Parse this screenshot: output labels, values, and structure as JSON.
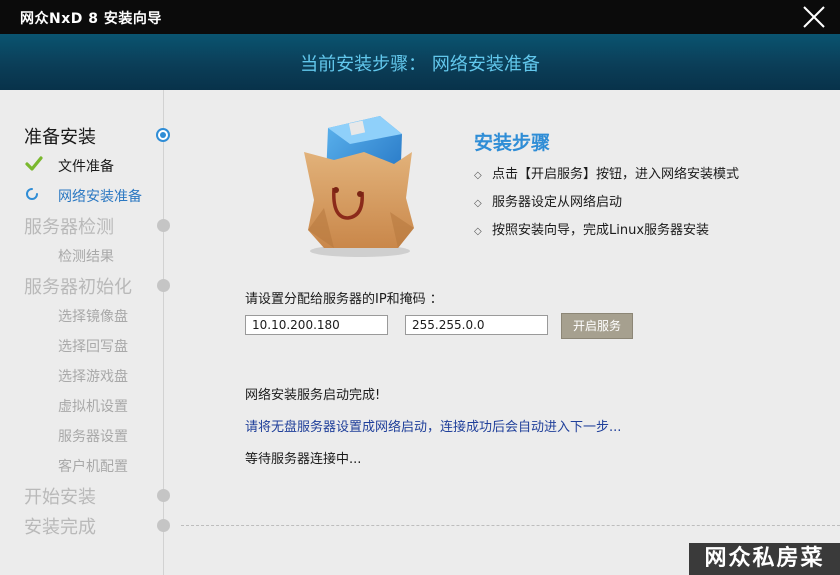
{
  "window": {
    "title": "网众NxD 8 安装向导"
  },
  "header": {
    "step_title": "当前安装步骤：  网络安装准备"
  },
  "sidebar": {
    "items": [
      {
        "label": "准备安装",
        "level": "main",
        "state": "active"
      },
      {
        "label": "文件准备",
        "level": "sub",
        "state": "done",
        "icon": "check-icon"
      },
      {
        "label": "网络安装准备",
        "level": "sub",
        "state": "current",
        "icon": "spinner-icon"
      },
      {
        "label": "服务器检测",
        "level": "main",
        "state": "pending"
      },
      {
        "label": "检测结果",
        "level": "sub",
        "state": "pending"
      },
      {
        "label": "服务器初始化",
        "level": "main",
        "state": "pending"
      },
      {
        "label": "选择镜像盘",
        "level": "sub",
        "state": "pending"
      },
      {
        "label": "选择回写盘",
        "level": "sub",
        "state": "pending"
      },
      {
        "label": "选择游戏盘",
        "level": "sub",
        "state": "pending"
      },
      {
        "label": "虚拟机设置",
        "level": "sub",
        "state": "pending"
      },
      {
        "label": "服务器设置",
        "level": "sub",
        "state": "pending"
      },
      {
        "label": "客户机配置",
        "level": "sub",
        "state": "pending"
      },
      {
        "label": "开始安装",
        "level": "main",
        "state": "pending"
      },
      {
        "label": "安装完成",
        "level": "main",
        "state": "pending"
      }
    ]
  },
  "main": {
    "image": "shopping-bag-package-icon",
    "steps_title": "安装步骤",
    "steps": [
      "点击【开启服务】按钮，进入网络安装模式",
      "服务器设定从网络启动",
      "按照安装向导，完成Linux服务器安装"
    ],
    "ip_label": "请设置分配给服务器的IP和掩码 ：",
    "ip_value": "10.10.200.180",
    "mask_value": "255.255.0.0",
    "start_button": "开启服务",
    "messages": [
      "网络安装服务启动完成!",
      "请将无盘服务器设置成网络启动，连接成功后会自动进入下一步...",
      "等待服务器连接中..."
    ]
  },
  "watermark": "网众私房菜",
  "colors": {
    "accent_blue": "#2f8dd6",
    "header_text": "#62c7ec",
    "titlebar_bg": "#0b0b0b",
    "check_green": "#7ab82e",
    "message_blue": "#1f3f9a"
  }
}
